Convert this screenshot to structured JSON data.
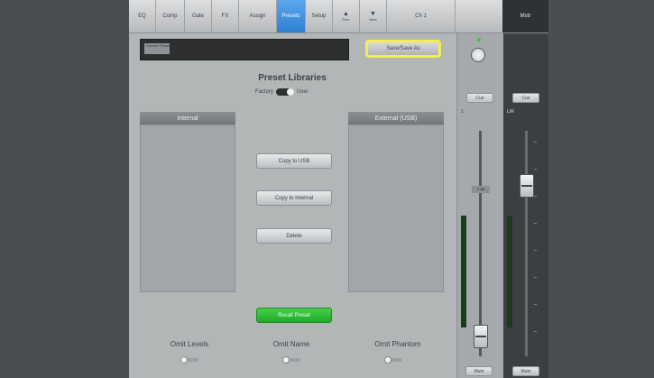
{
  "tabs": [
    {
      "label": "EQ"
    },
    {
      "label": "Comp"
    },
    {
      "label": "Gate"
    },
    {
      "label": "FX"
    },
    {
      "label": "Assign"
    },
    {
      "label": "Presets"
    },
    {
      "label": "Setup"
    },
    {
      "label": "Prev",
      "icon": "▲"
    },
    {
      "label": "Next",
      "icon": "▼"
    },
    {
      "label": "Ch 1"
    },
    {
      "label": "Mstr"
    }
  ],
  "preset_name": {
    "tag": "Current Preset",
    "value": ""
  },
  "save_button": "Save/Save As",
  "library": {
    "title": "Preset Libraries",
    "toggle_left": "Factory",
    "toggle_right": "User",
    "internal_header": "Internal",
    "external_header": "External (USB)"
  },
  "actions": {
    "copy_to_usb": "Copy to USB",
    "copy_to_internal": "Copy to Internal",
    "delete": "Delete",
    "recall": "Recall Preset"
  },
  "omit": {
    "levels": "Omit Levels",
    "name": "Omit Name",
    "phantom": "Omit Phantom"
  },
  "channel_strip": {
    "cue": "Cue",
    "mute": "Mute",
    "marker": "1",
    "gain_tag": "0 dB"
  },
  "master_strip": {
    "cue": "Cue",
    "mute": "Mute",
    "label": "L/R"
  },
  "colors": {
    "active_tab": "#3a8fe0",
    "highlight": "#f3ef52",
    "recall_green": "#2fbf35",
    "meter_green": "#1d3a1d"
  }
}
